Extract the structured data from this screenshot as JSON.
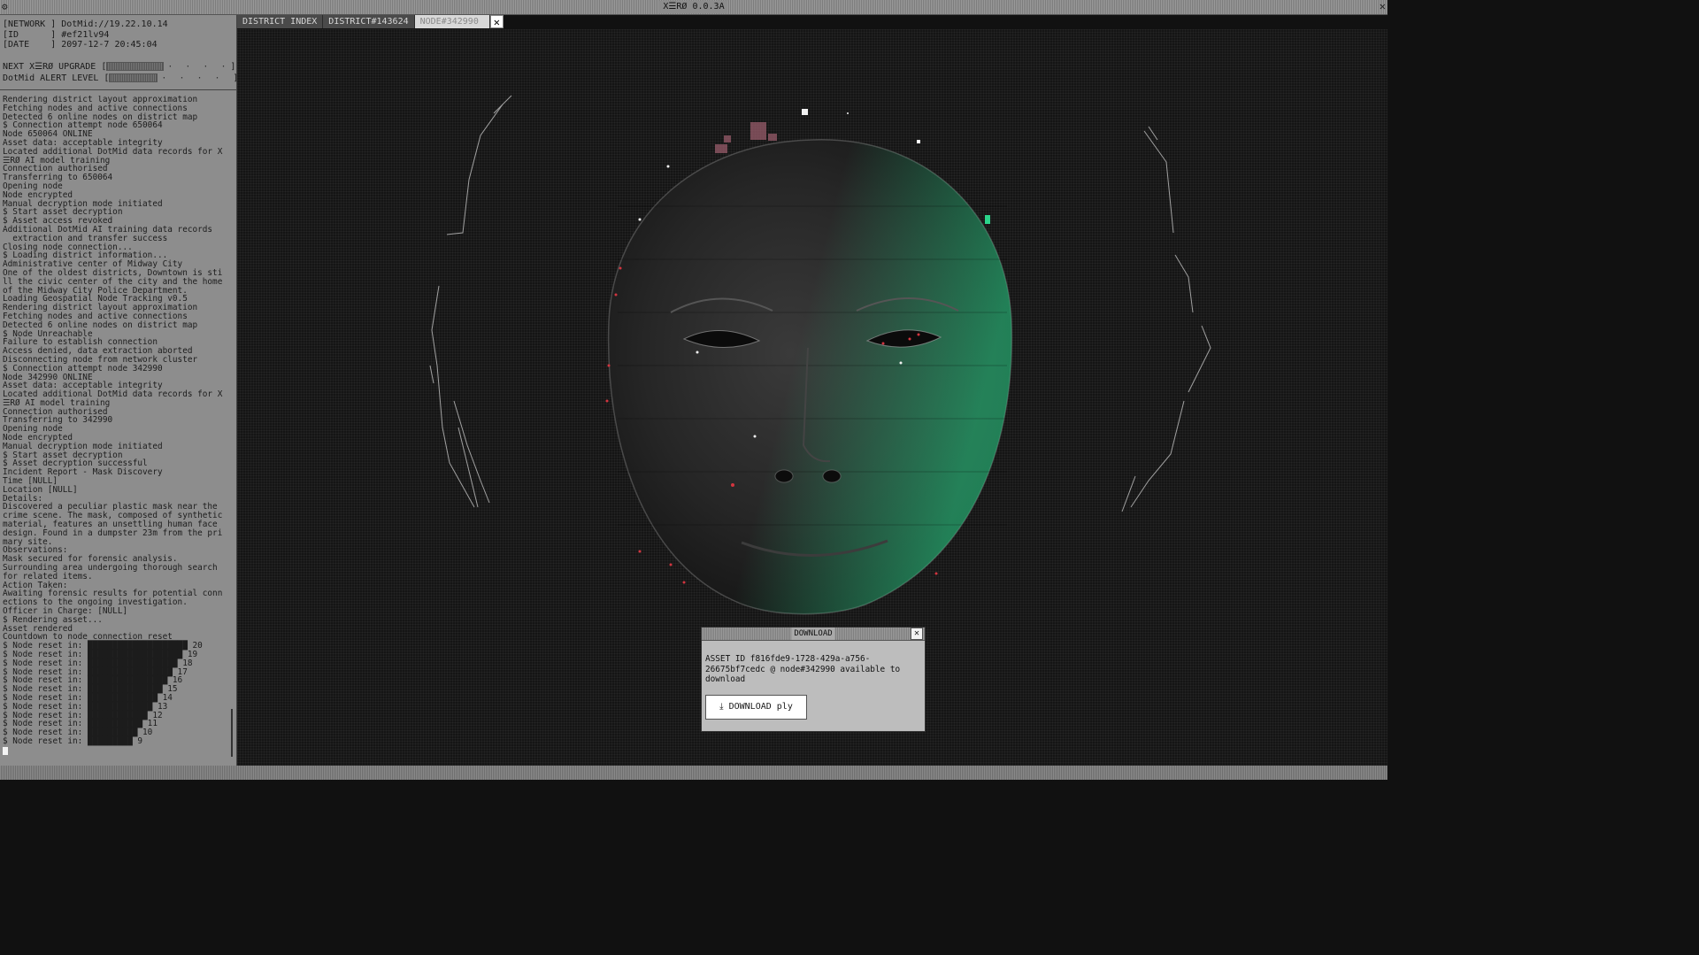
{
  "app": {
    "title": "X☰RØ 0.0.3A"
  },
  "status": {
    "network_label": "NETWORK",
    "network_value": "DotMid://19.22.10.14",
    "id_label": "ID",
    "id_value": "#ef21lv94",
    "date_label": "DATE",
    "date_value": "2097-12-7 20:45:04"
  },
  "meters": [
    {
      "label": "NEXT X☰RØ UPGRADE",
      "fill_fraction": 0.45
    },
    {
      "label": "DotMid ALERT LEVEL",
      "fill_fraction": 0.38
    }
  ],
  "log": [
    "Rendering district layout approximation",
    "Fetching nodes and active connections",
    "Detected 6 online nodes on district map",
    "$ Connection attempt node 650064",
    "Node 650064 ONLINE",
    "Asset data: acceptable integrity",
    "Located additional DotMid data records for X☰RØ AI model training",
    "Connection authorised",
    "Transferring to 650064",
    "Opening node",
    "Node encrypted",
    "Manual decryption mode initiated",
    "$ Start asset decryption",
    "$ Asset access revoked",
    "Additional DotMid AI training data records",
    "  extraction and transfer success",
    "Closing node connection...",
    "$ Loading district information...",
    "Administrative center of Midway City",
    "One of the oldest districts, Downtown is still the civic center of the city and the home of the Midway City Police Department.",
    "Loading Geospatial Node Tracking v0.5",
    "Rendering district layout approximation",
    "Fetching nodes and active connections",
    "Detected 6 online nodes on district map",
    "$ Node Unreachable",
    "Failure to establish connection",
    "Access denied, data extraction aborted",
    "Disconnecting node from network cluster",
    "$ Connection attempt node 342990",
    "Node 342990 ONLINE",
    "Asset data: acceptable integrity",
    "Located additional DotMid data records for X☰RØ AI model training",
    "Connection authorised",
    "Transferring to 342990",
    "Opening node",
    "Node encrypted",
    "Manual decryption mode initiated",
    "$ Start asset decryption",
    "$ Asset decryption successful",
    "Incident Report - Mask Discovery",
    "Time [NULL]",
    "Location [NULL]",
    "Details:",
    "Discovered a peculiar plastic mask near the crime scene. The mask, composed of synthetic material, features an unsettling human face design. Found in a dumpster 23m from the primary site.",
    "Observations:",
    "Mask secured for forensic analysis.",
    "Surrounding area undergoing thorough search for related items.",
    "Action Taken:",
    "Awaiting forensic results for potential connections to the ongoing investigation.",
    "Officer in Charge: [NULL]",
    "$ Rendering asset...",
    "Asset rendered",
    "Countdown to node connection reset",
    "$ Node reset in: ████████████████████ 20",
    "$ Node reset in: ███████████████████ 19",
    "$ Node reset in: ██████████████████ 18",
    "$ Node reset in: █████████████████ 17",
    "$ Node reset in: ████████████████ 16",
    "$ Node reset in: ███████████████ 15",
    "$ Node reset in: ██████████████ 14",
    "$ Node reset in: █████████████ 13",
    "$ Node reset in: ████████████ 12",
    "$ Node reset in: ███████████ 11",
    "$ Node reset in: ██████████ 10",
    "$ Node reset in: █████████ 9"
  ],
  "tabs": [
    {
      "label": "DISTRICT INDEX"
    },
    {
      "label": "DISTRICT#143624"
    },
    {
      "label": "NODE#342990"
    }
  ],
  "dialog": {
    "title": "DOWNLOAD",
    "message": "ASSET ID f816fde9-1728-429a-a756-26675bf7cedc @ node#342990 available to download",
    "button_label": "⤓ DOWNLOAD ply"
  },
  "colors": {
    "accent_green": "#2bd48a",
    "accent_red": "#d2353f"
  }
}
